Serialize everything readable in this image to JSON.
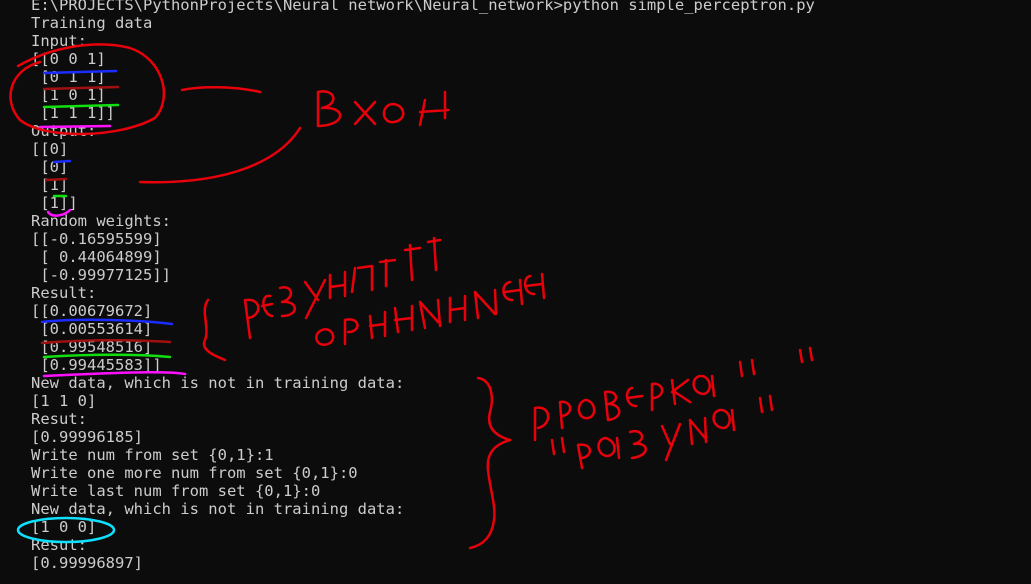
{
  "console": {
    "lines": [
      "E:\\PROJECTS\\PythonProjects\\Neural network\\Neural_network>python simple_perceptron.py",
      "Training data",
      "Input:",
      "[[0 0 1]",
      " [0 1 1]",
      " [1 0 1]",
      " [1 1 1]]",
      "Output:",
      "[[0]",
      " [0]",
      " [1]",
      " [1]]",
      "Random weights:",
      "[[-0.16595599]",
      " [ 0.44064899]",
      " [-0.99977125]]",
      "Result:",
      "[[0.00679672]",
      " [0.00553614]",
      " [0.99548516]",
      " [0.99445583]]",
      "New data, which is not in training data:",
      "[1 1 0]",
      "Resut:",
      "[0.99996185]",
      "Write num from set {0,1}:1",
      "Write one more num from set {0,1}:0",
      "Write last num from set {0,1}:0",
      "New data, which is not in training data:",
      "[1 0 0]",
      "Resut:",
      "[0.99996897]"
    ]
  },
  "colors": {
    "background": "#0c0c0c",
    "text": "#cccccc",
    "annotation_red": "#e8000b",
    "annotation_blue": "#1a2cff",
    "annotation_darkred": "#a01010",
    "annotation_green": "#10e010",
    "annotation_magenta": "#ff10ff",
    "annotation_cyan": "#10e0ff"
  }
}
